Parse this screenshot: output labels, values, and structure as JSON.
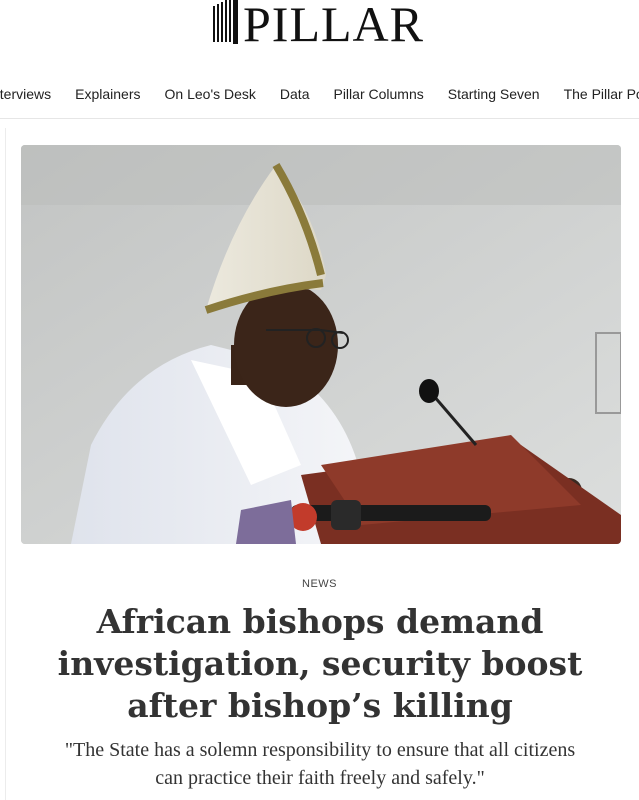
{
  "site": {
    "logo_text": "PILLAR",
    "logo_icon": "pillar-columns-icon"
  },
  "nav": {
    "items": [
      "nterviews",
      "Explainers",
      "On Leo's Desk",
      "Data",
      "Pillar Columns",
      "Starting Seven",
      "The Pillar Pod"
    ]
  },
  "article": {
    "category": "NEWS",
    "headline": "African bishops demand investigation, security boost after bishop’s killing",
    "dek": "\"The State has a solemn responsibility to ensure that all citizens can practice their faith freely and safely.\""
  },
  "colors": {
    "text": "#333333",
    "logo": "#111111",
    "divider": "#e2e2e2"
  }
}
